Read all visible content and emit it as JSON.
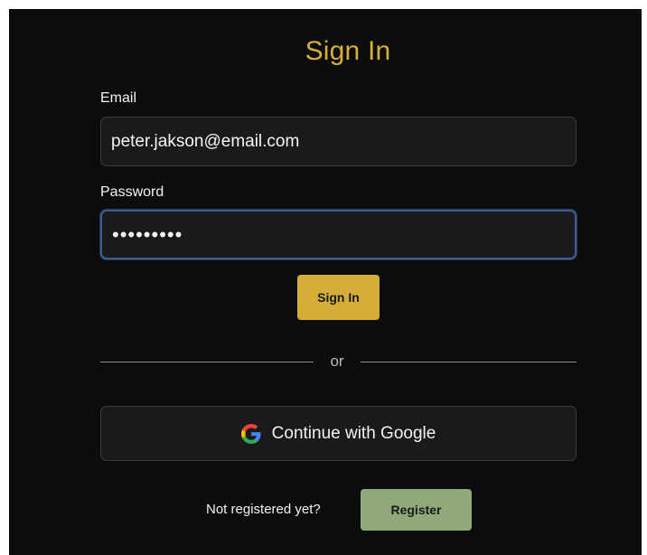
{
  "signin_form": {
    "title": "Sign In",
    "email": {
      "label": "Email",
      "value": "peter.jakson@email.com"
    },
    "password": {
      "label": "Password",
      "value": "•••••••••"
    },
    "submit_label": "Sign In",
    "divider_text": "or",
    "google_button": {
      "label": "Continue with Google",
      "icon": "google-icon"
    },
    "register_prompt": "Not registered yet?",
    "register_label": "Register"
  },
  "colors": {
    "background": "#0c0c0c",
    "accent_gold": "#d4ae38",
    "register_green": "#8fa97a",
    "focus_blue": "#3d5b8c",
    "input_background": "#1a1a1a"
  }
}
